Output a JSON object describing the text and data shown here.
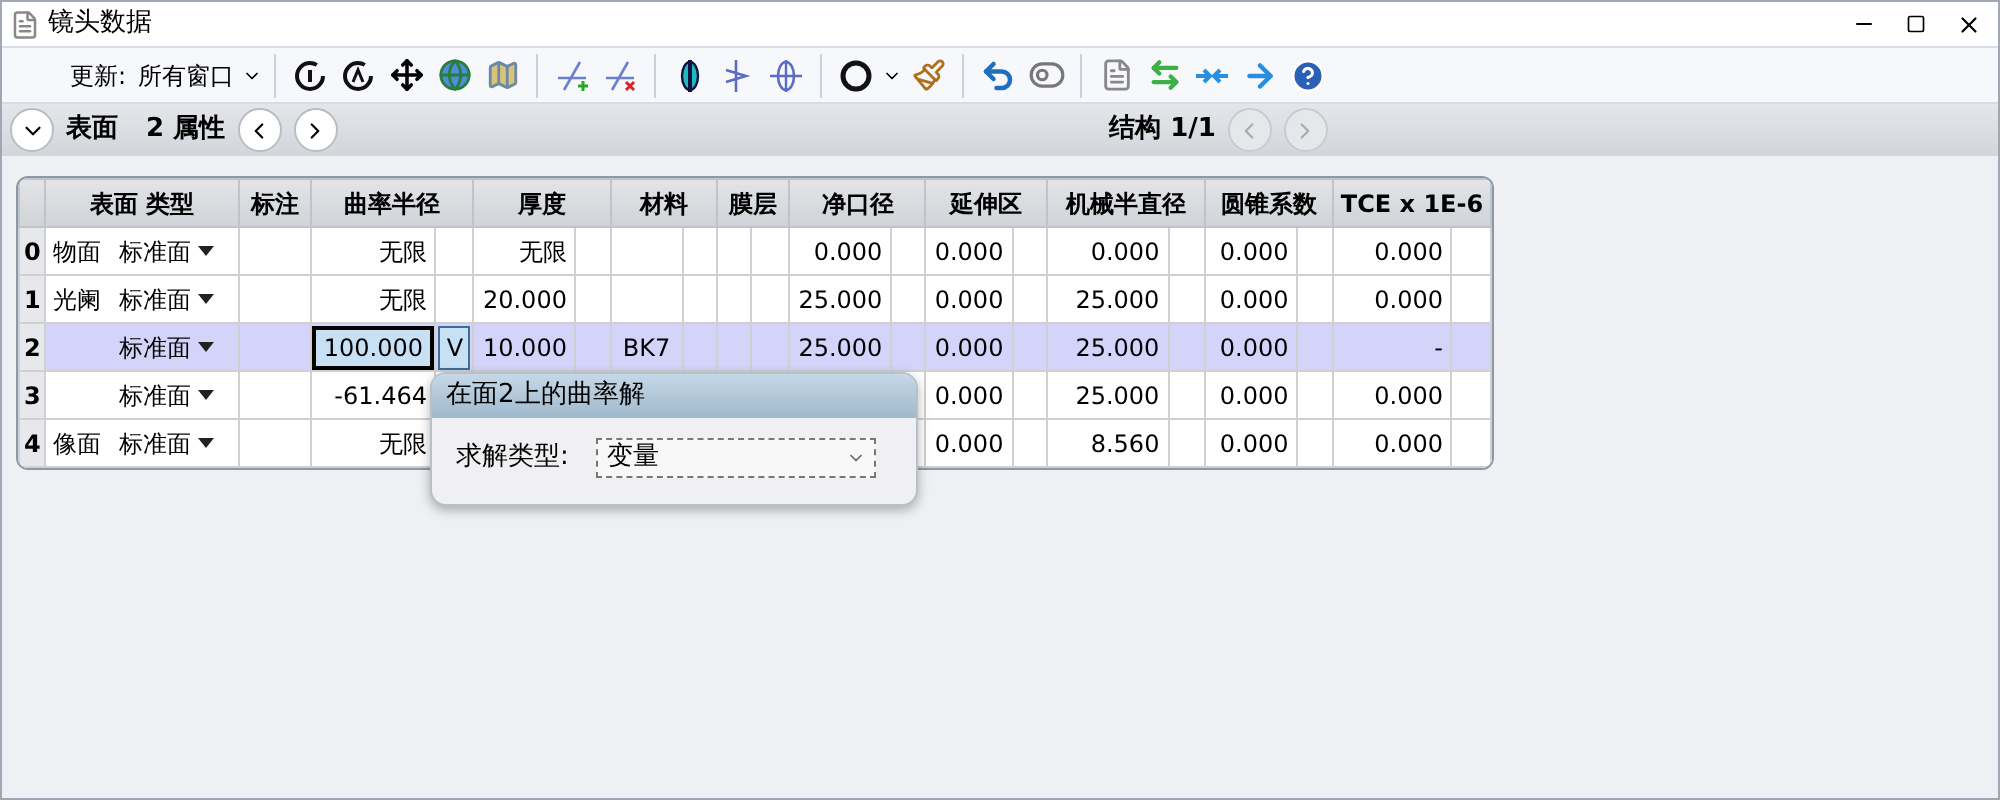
{
  "window": {
    "title": "镜头数据"
  },
  "toolbar": {
    "update_label": "更新:",
    "update_value": "所有窗口"
  },
  "navbar": {
    "surface_label": "表面",
    "property_label": "2 属性",
    "config_label": "结构 1/1"
  },
  "table": {
    "columns": [
      "表面 类型",
      "标注",
      "曲率半径",
      "厚度",
      "材料",
      "膜层",
      "净口径",
      "延伸区",
      "机械半直径",
      "圆锥系数",
      "TCE x 1E-6"
    ],
    "rows": [
      {
        "index": "0",
        "comment": "物面",
        "type": "标准面",
        "radius": "无限",
        "thickness": "无限",
        "clear": "0.000",
        "chip": "0.000",
        "mech": "0.000",
        "conic": "0.000",
        "tce": "0.000",
        "selected": false
      },
      {
        "index": "1",
        "comment": "光阑",
        "type": "标准面",
        "radius": "无限",
        "thickness": "20.000",
        "clear": "25.000",
        "chip": "0.000",
        "mech": "25.000",
        "conic": "0.000",
        "tce": "0.000",
        "selected": false
      },
      {
        "index": "2",
        "type": "标准面",
        "radius": "100.000",
        "radius_solve": "V",
        "thickness": "10.000",
        "material": "BK7",
        "clear": "25.000",
        "chip": "0.000",
        "mech": "25.000",
        "conic": "0.000",
        "tce": "-",
        "selected": true
      },
      {
        "index": "3",
        "type": "标准面",
        "radius": "-61.464",
        "chip": "0.000",
        "mech": "25.000",
        "conic": "0.000",
        "tce": "0.000",
        "selected": false
      },
      {
        "index": "4",
        "comment": "像面",
        "type": "标准面",
        "radius": "无限",
        "chip": "0.000",
        "mech": "8.560",
        "conic": "0.000",
        "tce": "0.000",
        "selected": false
      }
    ]
  },
  "solve_popup": {
    "title": "在面2上的曲率解",
    "label": "求解类型:",
    "value": "变量"
  }
}
